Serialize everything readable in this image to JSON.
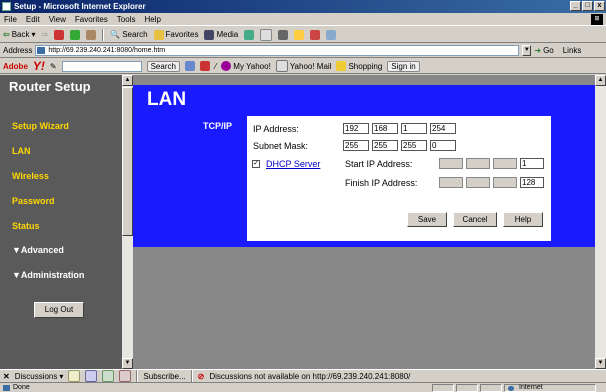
{
  "window": {
    "title": "Setup - Microsoft Internet Explorer",
    "buttons": [
      "_",
      "□",
      "x"
    ]
  },
  "menu": [
    "File",
    "Edit",
    "View",
    "Favorites",
    "Tools",
    "Help"
  ],
  "toolbar": {
    "back": "Back",
    "forward": "",
    "search": "Search",
    "favorites": "Favorites",
    "media": "Media"
  },
  "address": {
    "label": "Address",
    "url": "http://69.239.240.241:8080/home.htm",
    "go": "Go",
    "links": "Links"
  },
  "yahoo": {
    "brand": "Adobe",
    "logo": "Y!",
    "search_btn": "Search",
    "my_yahoo": "My Yahoo!",
    "mail": "Yahoo! Mail",
    "shopping": "Shopping",
    "signin": "Sign in"
  },
  "sidebar": {
    "title": "Router Setup",
    "items": [
      {
        "label": "Setup Wizard"
      },
      {
        "label": "LAN"
      },
      {
        "label": "Wireless"
      },
      {
        "label": "Password"
      },
      {
        "label": "Status"
      },
      {
        "label": "▼Advanced"
      },
      {
        "label": "▼Administration"
      }
    ],
    "logout": "Log Out"
  },
  "main": {
    "title": "LAN",
    "section": "TCP/IP",
    "ip_label": "IP Address:",
    "ip": [
      "192",
      "168",
      "1",
      "254"
    ],
    "mask_label": "Subnet Mask:",
    "mask": [
      "255",
      "255",
      "255",
      "0"
    ],
    "dhcp_checked": "✓",
    "dhcp_label": "DHCP Server",
    "start_label": "Start IP Address:",
    "start": [
      "",
      "",
      "",
      "1"
    ],
    "finish_label": "Finish IP Address:",
    "finish": [
      "",
      "",
      "",
      "128"
    ],
    "save": "Save",
    "cancel": "Cancel",
    "help": "Help"
  },
  "discussion": {
    "label": "Discussions",
    "subscribe": "Subscribe...",
    "message": "Discussions not available on http://69.239.240.241:8080/"
  },
  "status": {
    "text": "Done",
    "zone": "Internet"
  },
  "colors": {
    "lan_blue": "#1a1aff",
    "nav_yellow": "#ffd700",
    "sidebar_bg": "#5a5a5a",
    "content_bg": "#888888"
  }
}
